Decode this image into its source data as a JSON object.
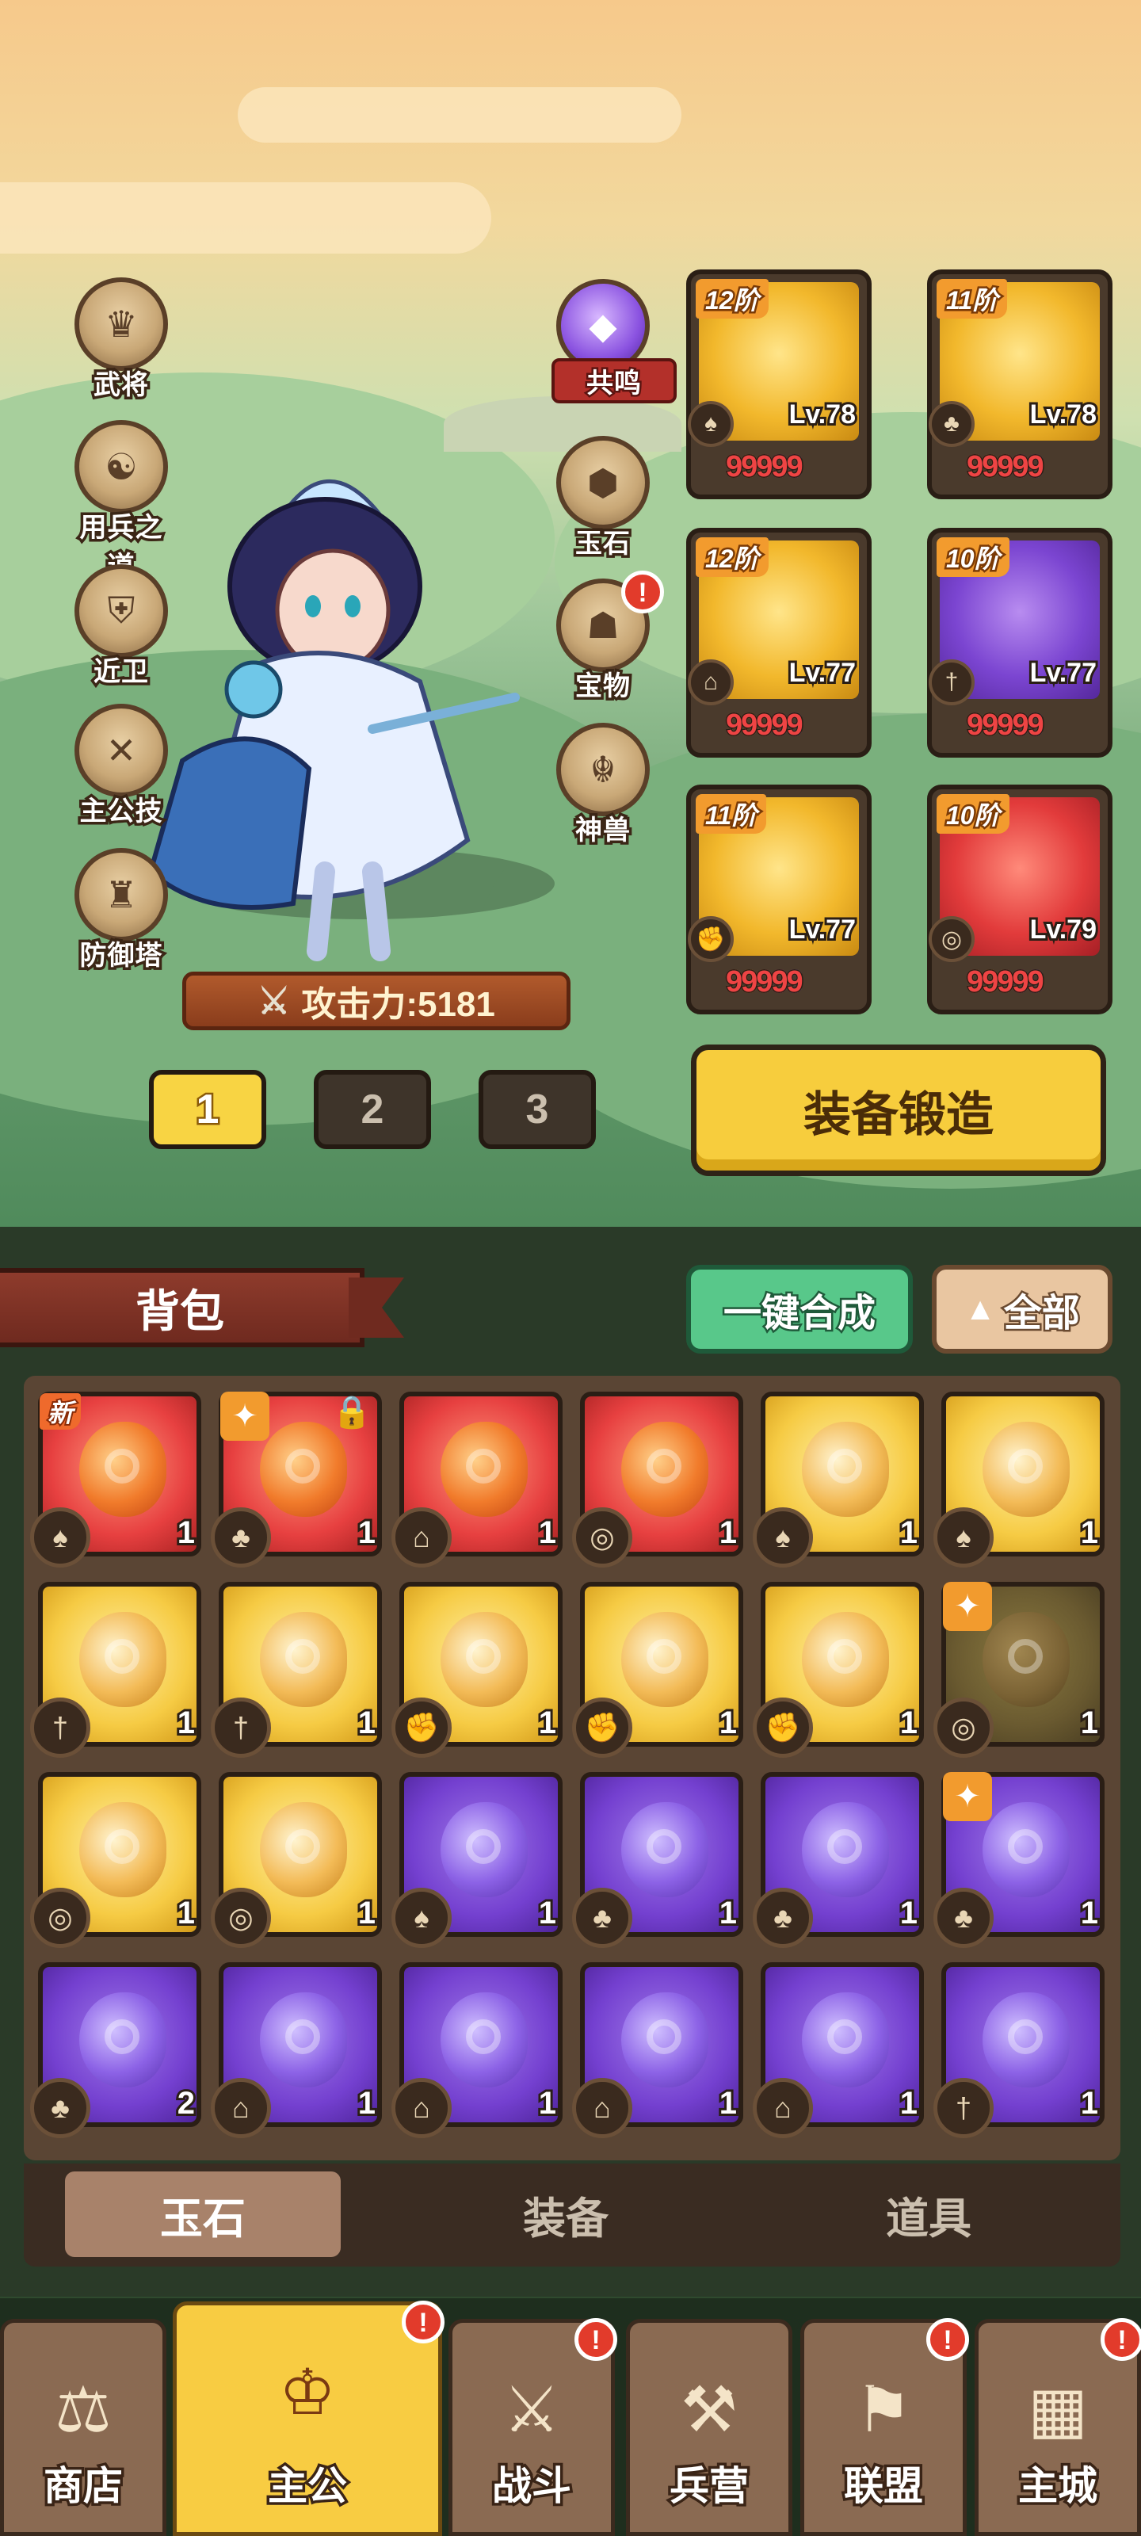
{
  "side_left": [
    {
      "label": "武将",
      "icon": "general-icon"
    },
    {
      "label": "用兵之道",
      "icon": "strategy-icon"
    },
    {
      "label": "近卫",
      "icon": "guard-icon"
    },
    {
      "label": "主公技",
      "icon": "lord-skill-icon"
    },
    {
      "label": "防御塔",
      "icon": "tower-icon"
    }
  ],
  "side_right": [
    {
      "label": "共鸣",
      "icon": "resonance-icon",
      "badge": ""
    },
    {
      "label": "玉石",
      "icon": "jade-icon",
      "badge": ""
    },
    {
      "label": "宝物",
      "icon": "treasure-icon",
      "badge": "!"
    },
    {
      "label": "神兽",
      "icon": "divine-beast-icon",
      "badge": ""
    }
  ],
  "power": {
    "label": "攻击力:5181"
  },
  "pages": [
    "1",
    "2",
    "3"
  ],
  "forge_label": "装备锻造",
  "equipment": [
    {
      "tier": "12阶",
      "level": "Lv.78",
      "stars": "99999",
      "rarity": "gold",
      "slot_icon": "helmet-slot-icon"
    },
    {
      "tier": "11阶",
      "level": "Lv.78",
      "stars": "99999",
      "rarity": "gold",
      "slot_icon": "armor-slot-icon"
    },
    {
      "tier": "12阶",
      "level": "Lv.77",
      "stars": "99999",
      "rarity": "gold",
      "slot_icon": "boots-slot-icon"
    },
    {
      "tier": "10阶",
      "level": "Lv.77",
      "stars": "99999",
      "rarity": "purple",
      "slot_icon": "weapon-slot-icon"
    },
    {
      "tier": "11阶",
      "level": "Lv.77",
      "stars": "99999",
      "rarity": "gold",
      "slot_icon": "gauntlet-slot-icon"
    },
    {
      "tier": "10阶",
      "level": "Lv.79",
      "stars": "99999",
      "rarity": "red",
      "slot_icon": "ring-slot-icon"
    }
  ],
  "bag_title": "背包",
  "combine_label": "一键合成",
  "filter_label": "全部",
  "inventory": [
    {
      "rarity": "red",
      "qty": "1",
      "tag": "新",
      "spark": false,
      "lock": false,
      "slot_icon": "helmet-slot-icon"
    },
    {
      "rarity": "red",
      "qty": "1",
      "tag": "",
      "spark": true,
      "lock": true,
      "slot_icon": "armor-slot-icon"
    },
    {
      "rarity": "red",
      "qty": "1",
      "tag": "",
      "spark": false,
      "lock": false,
      "slot_icon": "boots-slot-icon"
    },
    {
      "rarity": "red",
      "qty": "1",
      "tag": "",
      "spark": false,
      "lock": false,
      "slot_icon": "ring-slot-icon"
    },
    {
      "rarity": "gold",
      "qty": "1",
      "tag": "",
      "spark": false,
      "lock": false,
      "slot_icon": "helmet-slot-icon"
    },
    {
      "rarity": "gold",
      "qty": "1",
      "tag": "",
      "spark": false,
      "lock": false,
      "slot_icon": "helmet-slot-icon"
    },
    {
      "rarity": "gold",
      "qty": "1",
      "tag": "",
      "spark": false,
      "lock": false,
      "slot_icon": "weapon-slot-icon"
    },
    {
      "rarity": "gold",
      "qty": "1",
      "tag": "",
      "spark": false,
      "lock": false,
      "slot_icon": "weapon-slot-icon"
    },
    {
      "rarity": "gold",
      "qty": "1",
      "tag": "",
      "spark": false,
      "lock": false,
      "slot_icon": "gauntlet-slot-icon"
    },
    {
      "rarity": "gold",
      "qty": "1",
      "tag": "",
      "spark": false,
      "lock": false,
      "slot_icon": "gauntlet-slot-icon"
    },
    {
      "rarity": "gold",
      "qty": "1",
      "tag": "",
      "spark": false,
      "lock": false,
      "slot_icon": "gauntlet-slot-icon"
    },
    {
      "rarity": "dim",
      "qty": "1",
      "tag": "",
      "spark": true,
      "lock": false,
      "slot_icon": "ring-slot-icon"
    },
    {
      "rarity": "gold",
      "qty": "1",
      "tag": "",
      "spark": false,
      "lock": false,
      "slot_icon": "ring-slot-icon"
    },
    {
      "rarity": "gold",
      "qty": "1",
      "tag": "",
      "spark": false,
      "lock": false,
      "slot_icon": "ring-slot-icon"
    },
    {
      "rarity": "purple",
      "qty": "1",
      "tag": "",
      "spark": false,
      "lock": false,
      "slot_icon": "helmet-slot-icon"
    },
    {
      "rarity": "purple",
      "qty": "1",
      "tag": "",
      "spark": false,
      "lock": false,
      "slot_icon": "armor-slot-icon"
    },
    {
      "rarity": "purple",
      "qty": "1",
      "tag": "",
      "spark": false,
      "lock": false,
      "slot_icon": "armor-slot-icon"
    },
    {
      "rarity": "purple",
      "qty": "1",
      "tag": "",
      "spark": true,
      "lock": false,
      "slot_icon": "armor-slot-icon"
    },
    {
      "rarity": "purple",
      "qty": "2",
      "tag": "",
      "spark": false,
      "lock": false,
      "slot_icon": "armor-slot-icon"
    },
    {
      "rarity": "purple",
      "qty": "1",
      "tag": "",
      "spark": false,
      "lock": false,
      "slot_icon": "boots-slot-icon"
    },
    {
      "rarity": "purple",
      "qty": "1",
      "tag": "",
      "spark": false,
      "lock": false,
      "slot_icon": "boots-slot-icon"
    },
    {
      "rarity": "purple",
      "qty": "1",
      "tag": "",
      "spark": false,
      "lock": false,
      "slot_icon": "boots-slot-icon"
    },
    {
      "rarity": "purple",
      "qty": "1",
      "tag": "",
      "spark": false,
      "lock": false,
      "slot_icon": "boots-slot-icon"
    },
    {
      "rarity": "purple",
      "qty": "1",
      "tag": "",
      "spark": false,
      "lock": false,
      "slot_icon": "weapon-slot-icon"
    }
  ],
  "sub_tabs": [
    "玉石",
    "装备",
    "道具"
  ],
  "nav": [
    {
      "label": "商店",
      "icon": "shop-icon",
      "badge": "",
      "active": false
    },
    {
      "label": "主公",
      "icon": "lord-icon",
      "badge": "!",
      "active": true
    },
    {
      "label": "战斗",
      "icon": "battle-icon",
      "badge": "!",
      "active": false
    },
    {
      "label": "兵营",
      "icon": "barracks-icon",
      "badge": "",
      "active": false
    },
    {
      "label": "联盟",
      "icon": "alliance-icon",
      "badge": "!",
      "active": false
    },
    {
      "label": "主城",
      "icon": "main-city-icon",
      "badge": "!",
      "active": false
    }
  ]
}
